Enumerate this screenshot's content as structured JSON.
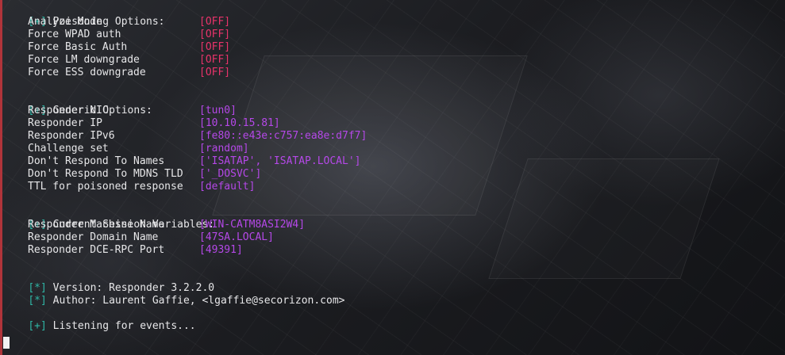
{
  "sections": {
    "poisoning": {
      "marker": "[+]",
      "header": "Poisoning Options:",
      "rows": [
        {
          "label": "Analyze Mode",
          "value": "[OFF]"
        },
        {
          "label": "Force WPAD auth",
          "value": "[OFF]"
        },
        {
          "label": "Force Basic Auth",
          "value": "[OFF]"
        },
        {
          "label": "Force LM downgrade",
          "value": "[OFF]"
        },
        {
          "label": "Force ESS downgrade",
          "value": "[OFF]"
        }
      ]
    },
    "generic": {
      "marker": "[+]",
      "header": "Generic Options:",
      "rows": [
        {
          "label": "Responder NIC",
          "value": "[tun0]"
        },
        {
          "label": "Responder IP",
          "value": "[10.10.15.81]"
        },
        {
          "label": "Responder IPv6",
          "value": "[fe80::e43e:c757:ea8e:d7f7]"
        },
        {
          "label": "Challenge set",
          "value": "[random]"
        },
        {
          "label": "Don't Respond To Names",
          "value": "['ISATAP', 'ISATAP.LOCAL']"
        },
        {
          "label": "Don't Respond To MDNS TLD",
          "value": "['_DOSVC']"
        },
        {
          "label": "TTL for poisoned response",
          "value": "[default]"
        }
      ]
    },
    "session": {
      "marker": "[+]",
      "header": "Current Session Variables:",
      "rows": [
        {
          "label": "Responder Machine Name",
          "value": "[WIN-CATM8ASI2W4]"
        },
        {
          "label": "Responder Domain Name",
          "value": "[47SA.LOCAL]"
        },
        {
          "label": "Responder DCE-RPC Port",
          "value": "[49391]"
        }
      ]
    }
  },
  "info": {
    "version_marker": "[*]",
    "version": "Version: Responder 3.2.2.0",
    "author_marker": "[*]",
    "author": "Author: Laurent Gaffie, <lgaffie@secorizon.com>"
  },
  "status": {
    "marker": "[+]",
    "text": "Listening for events..."
  },
  "colors": {
    "marker": "#2fb7a6",
    "off": "#e8336a",
    "value": "#b548e8",
    "text": "#e7e7e9"
  }
}
